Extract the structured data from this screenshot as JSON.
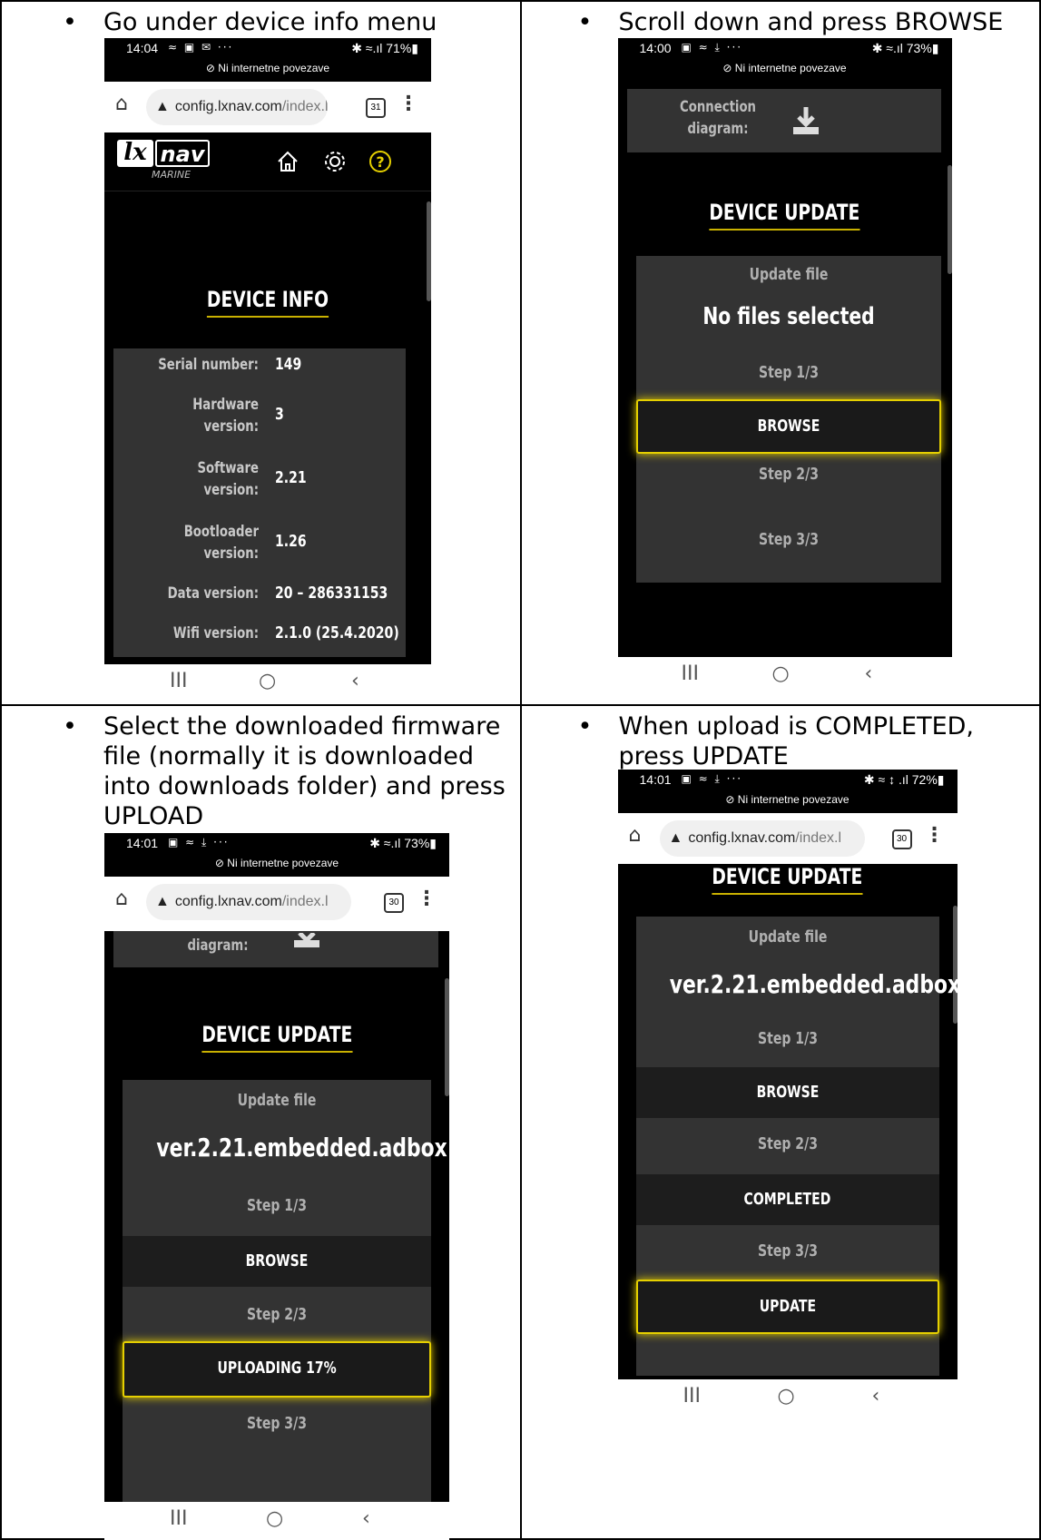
{
  "cells": [
    {
      "instruction": [
        "Go under device info menu"
      ],
      "status": {
        "time": "14:04",
        "icons": "≈ ▣ ✉ ···",
        "right": "✱ ≈.ıl 71%▮",
        "network": "⊘  Ni internetne povezave"
      },
      "url": {
        "host": "config.lxnav.com",
        "path": "/index.l",
        "tabs": "31"
      },
      "logo": {
        "lx": "lx",
        "nav": "nav",
        "marine": "MARINE"
      },
      "title": "DEVICE INFO",
      "rows": [
        {
          "label": "Serial number:",
          "value": "149"
        },
        {
          "label": "Hardware\nversion:",
          "value": "3"
        },
        {
          "label": "Software\nversion:",
          "value": "2.21"
        },
        {
          "label": "Bootloader\nversion:",
          "value": "1.26"
        },
        {
          "label": "Data version:",
          "value": "20 – 286331153"
        },
        {
          "label": "Wifi version:",
          "value": "2.1.0 (25.4.2020)"
        }
      ]
    },
    {
      "instruction": [
        "Scroll down and press BROWSE"
      ],
      "status": {
        "time": "14:00",
        "icons": "▣ ≈ ⤓ ···",
        "right": "✱ ≈.ıl 73%▮",
        "network": "⊘  Ni internetne povezave"
      },
      "connection": "Connection\ndiagram:",
      "title": "DEVICE UPDATE",
      "update_file": "Update file",
      "file": "No files selected",
      "step1": "Step 1/3",
      "btn1": "BROWSE",
      "step2": "Step 2/3",
      "step3": "Step 3/3"
    },
    {
      "instruction": [
        "Select the downloaded firmware",
        "file (normally it is downloaded",
        "into downloads folder) and press",
        "UPLOAD"
      ],
      "status": {
        "time": "14:01",
        "icons": "▣ ≈ ⤓ ···",
        "right": "✱ ≈.ıl 73%▮",
        "network": "⊘  Ni internetne povezave"
      },
      "url": {
        "host": "config.lxnav.com",
        "path": "/index.l",
        "tabs": "30"
      },
      "connection": "diagram:",
      "title": "DEVICE UPDATE",
      "update_file": "Update file",
      "file": "ver.2.21.embedded.adbox",
      "step1": "Step 1/3",
      "btn1": "BROWSE",
      "step2": "Step 2/3",
      "btn2": "UPLOADING 17%",
      "step3": "Step 3/3"
    },
    {
      "instruction": [
        "When upload is COMPLETED,",
        "press UPDATE"
      ],
      "status": {
        "time": "14:01",
        "icons": "▣ ≈ ⤓ ···",
        "right": "✱ ≈ ↕ .ıl 72%▮",
        "network": "⊘  Ni internetne povezave"
      },
      "url": {
        "host": "config.lxnav.com",
        "path": "/index.l",
        "tabs": "30"
      },
      "title": "DEVICE UPDATE",
      "update_file": "Update file",
      "file": "ver.2.21.embedded.adbox",
      "step1": "Step 1/3",
      "btn1": "BROWSE",
      "step2": "Step 2/3",
      "btn2": "COMPLETED",
      "step3": "Step 3/3",
      "btn3": "UPDATE"
    }
  ],
  "nav": {
    "recent": "III",
    "home": "○",
    "back": "‹"
  },
  "icons": {
    "home": "home-icon",
    "gear": "gear-icon",
    "help": "help-icon",
    "download": "download-icon"
  },
  "colors": {
    "accent": "#e6d000",
    "card": "#333333",
    "bg": "#000000"
  }
}
